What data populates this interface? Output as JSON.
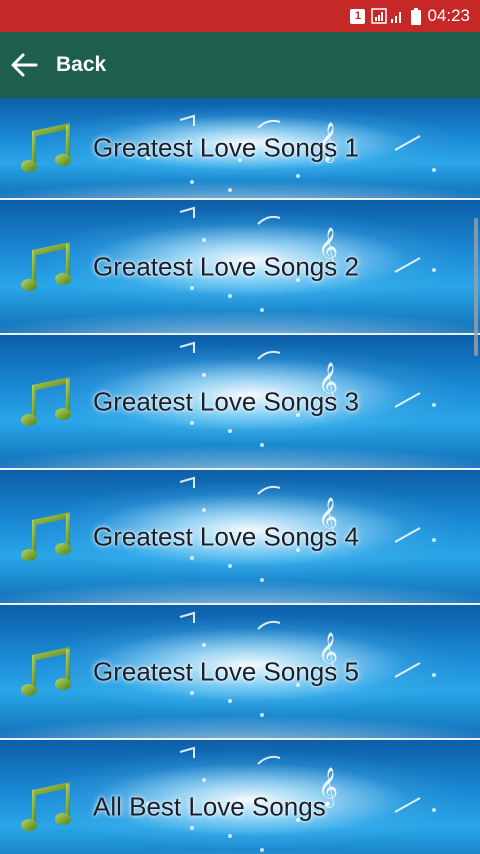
{
  "status_bar": {
    "notification_badge": "1",
    "time": "04:23"
  },
  "app_bar": {
    "back_label": "Back"
  },
  "items": [
    {
      "label": "Greatest Love Songs 1"
    },
    {
      "label": "Greatest Love Songs 2"
    },
    {
      "label": "Greatest Love Songs 3"
    },
    {
      "label": "Greatest Love Songs 4"
    },
    {
      "label": "Greatest Love Songs 5"
    },
    {
      "label": "All Best Love Songs"
    }
  ],
  "colors": {
    "status_bar": "#c62828",
    "app_bar": "#1e5e4c",
    "item_text": "#1a1f2a",
    "icon_green": "#6a9a1e"
  }
}
